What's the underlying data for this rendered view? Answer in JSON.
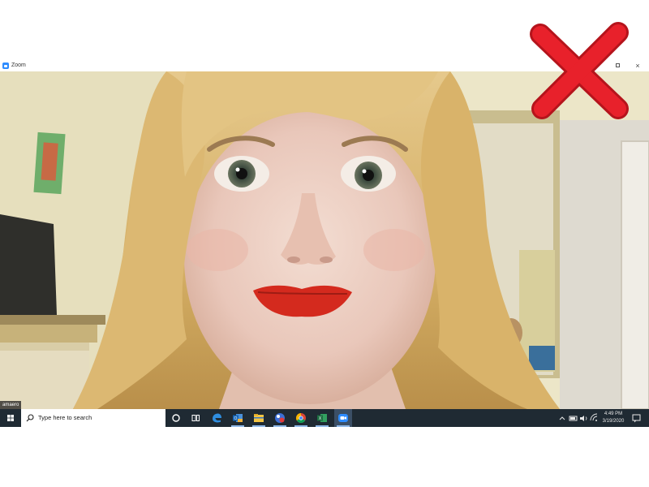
{
  "window": {
    "title": "Zoom",
    "restore_glyph": "restore-icon",
    "close_glyph": "×"
  },
  "video": {
    "participant_name": "amaero"
  },
  "overlay": {
    "icon": "red-x-icon",
    "color": "#e8212b"
  },
  "taskbar": {
    "search_placeholder": "Type here to search",
    "apps": [
      "cortana-icon",
      "task-view-icon",
      "edge-icon",
      "outlook-icon",
      "file-explorer-icon",
      "sticky-icon",
      "chrome-icon",
      "excel-icon",
      "zoom-icon"
    ],
    "time": "4:49 PM",
    "date": "3/19/2020"
  },
  "colors": {
    "taskbar": "#1f2a33",
    "zoom_blue": "#2d8cff"
  }
}
